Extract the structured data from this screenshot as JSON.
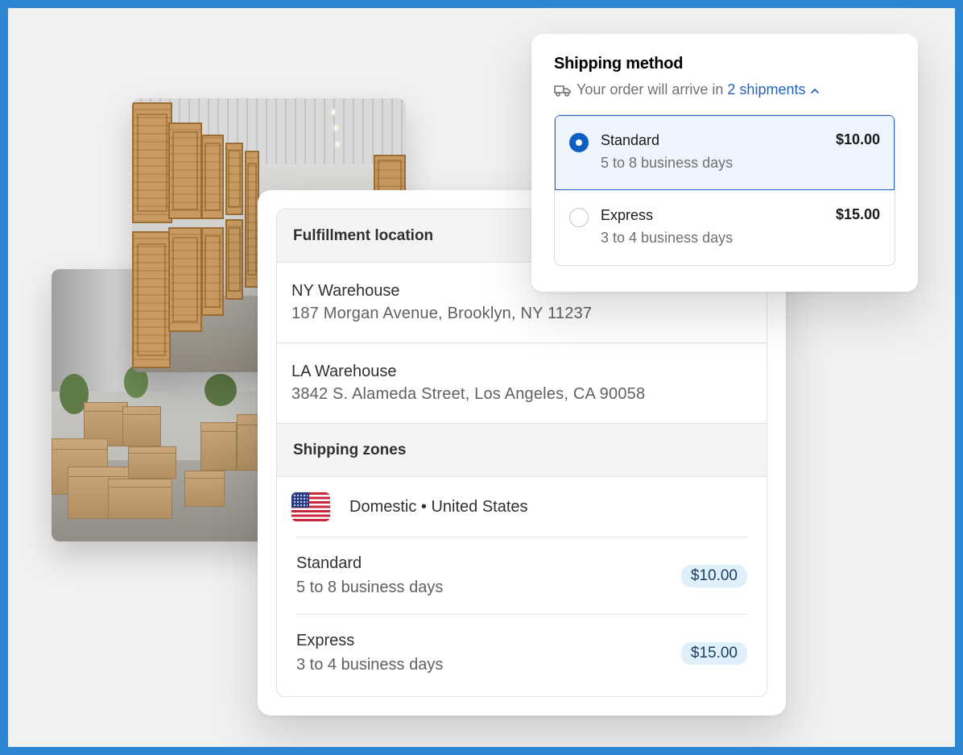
{
  "shipping_method": {
    "title": "Shipping method",
    "subtitle_prefix": "Your order will arrive in",
    "shipments_link": "2 shipments",
    "options": [
      {
        "name": "Standard",
        "days": "5 to 8 business days",
        "price": "$10.00",
        "selected": true
      },
      {
        "name": "Express",
        "days": "3 to 4 business days",
        "price": "$15.00",
        "selected": false
      }
    ]
  },
  "fulfillment": {
    "header": "Fulfillment location",
    "locations": [
      {
        "name": "NY Warehouse",
        "address": "187 Morgan Avenue, Brooklyn, NY 11237"
      },
      {
        "name": "LA Warehouse",
        "address": "3842 S. Alameda Street, Los Angeles, CA 90058"
      }
    ]
  },
  "zones": {
    "header": "Shipping zones",
    "zone_label": "Domestic • United States",
    "flag_icon": "us-flag-icon",
    "rates": [
      {
        "name": "Standard",
        "days": "5 to 8 business days",
        "price": "$10.00"
      },
      {
        "name": "Express",
        "days": "3 to 4 business days",
        "price": "$15.00"
      }
    ]
  },
  "colors": {
    "frame": "#2e86d3",
    "accent": "#2463bd",
    "selected_bg": "#eef5ff",
    "price_pill_bg": "#dff0fb"
  }
}
